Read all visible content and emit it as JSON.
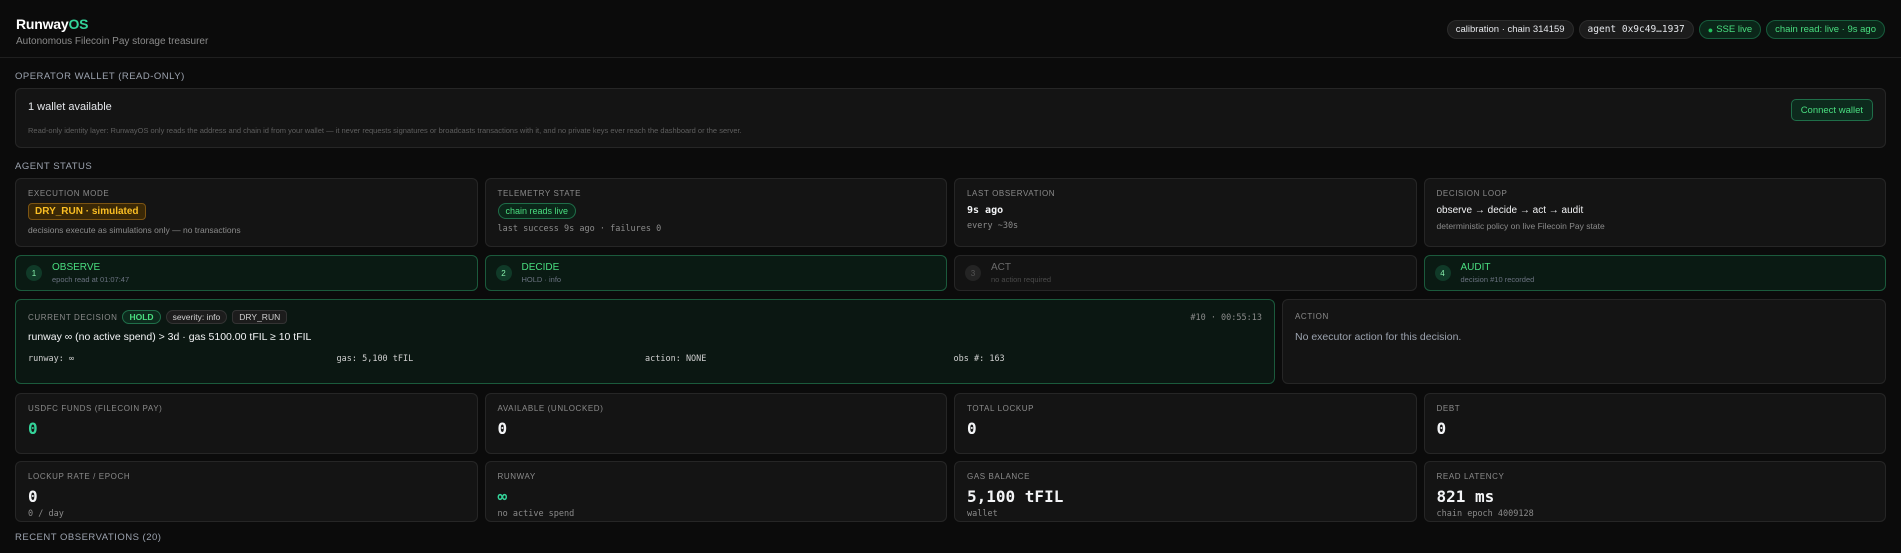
{
  "header": {
    "brand_main": "Runway",
    "brand_accent": "OS",
    "tagline": "Autonomous Filecoin Pay storage treasurer",
    "pills": {
      "network": "calibration · chain 314159",
      "agent": "agent 0x9c49…1937",
      "sse": "SSE live",
      "chain_read": "chain read: live · 9s ago"
    }
  },
  "wallet": {
    "section": "OPERATOR WALLET (READ-ONLY)",
    "title": "1 wallet available",
    "note": "Read-only identity layer: RunwayOS only reads the address and chain id from your wallet — it never requests signatures or broadcasts transactions with it, and no private keys ever reach the dashboard or the server.",
    "connect_label": "Connect wallet"
  },
  "agent_status": {
    "section": "AGENT STATUS",
    "execution": {
      "label": "EXECUTION MODE",
      "badge": "DRY_RUN · simulated",
      "sub": "decisions execute as simulations only — no transactions"
    },
    "telemetry": {
      "label": "TELEMETRY STATE",
      "badge": "chain reads live",
      "sub": "last success 9s ago · failures 0"
    },
    "observation": {
      "label": "LAST OBSERVATION",
      "value": "9s ago",
      "sub": "every ~30s"
    },
    "loop": {
      "label": "DECISION LOOP",
      "value": "observe → decide → act → audit",
      "sub": "deterministic policy on live Filecoin Pay state"
    }
  },
  "steps": [
    {
      "num": "1",
      "title": "OBSERVE",
      "sub": "epoch read at 01:07:47"
    },
    {
      "num": "2",
      "title": "DECIDE",
      "sub": "HOLD · info"
    },
    {
      "num": "3",
      "title": "ACT",
      "sub": "no action required"
    },
    {
      "num": "4",
      "title": "AUDIT",
      "sub": "decision #10 recorded"
    }
  ],
  "decision": {
    "label": "CURRENT DECISION",
    "verdict": "HOLD",
    "severity": "severity: info",
    "mode": "DRY_RUN",
    "meta": "#10 · 00:55:13",
    "summary": "runway ∞ (no active spend) > 3d · gas 5100.00 tFIL ≥ 10 tFIL",
    "facts": {
      "runway": "runway: ∞",
      "gas": "gas: 5,100 tFIL",
      "action": "action: NONE",
      "obs": "obs #: 163"
    }
  },
  "action": {
    "label": "ACTION",
    "text": "No executor action for this decision."
  },
  "metrics_row1": [
    {
      "label": "USDFC FUNDS (FILECOIN PAY)",
      "value": "0"
    },
    {
      "label": "AVAILABLE (UNLOCKED)",
      "value": "0"
    },
    {
      "label": "TOTAL LOCKUP",
      "value": "0"
    },
    {
      "label": "DEBT",
      "value": "0"
    }
  ],
  "metrics_row2": [
    {
      "label": "LOCKUP RATE / EPOCH",
      "value": "0",
      "sub": "0 / day"
    },
    {
      "label": "RUNWAY",
      "value": "∞",
      "sub": "no active spend"
    },
    {
      "label": "GAS BALANCE",
      "value": "5,100 tFIL",
      "sub": "wallet"
    },
    {
      "label": "READ LATENCY",
      "value": "821 ms",
      "sub": "chain epoch 4009128"
    }
  ],
  "recent_section": "RECENT OBSERVATIONS (20)",
  "colors": {
    "accent": "#34d399",
    "amber": "#fbbf24",
    "background": "#0b0b0b"
  }
}
